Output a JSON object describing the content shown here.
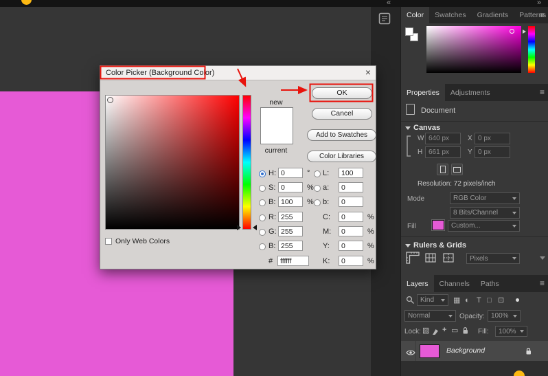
{
  "colors": {
    "pink": "#e65ad6",
    "annotation": "#e8130c",
    "yellow": "#fdb912",
    "hue_magenta": "#ff00e0"
  },
  "topbar": {
    "collapse_left": "«",
    "collapse_right": "»"
  },
  "icons": {
    "menu": "≡",
    "close": "×",
    "pixel_filter": "▦",
    "adjustment_filter": "◐",
    "type_filter": "T",
    "shape_filter": "□",
    "smart_filter": "⊡",
    "lock_transparency": "▨",
    "lock_position": "+",
    "lock_artboard": "▭"
  },
  "dialog": {
    "title": "Color Picker (Background Color)",
    "new_label": "new",
    "current_label": "current",
    "ok_label": "OK",
    "cancel_label": "Cancel",
    "add_to_swatches_label": "Add to Swatches",
    "color_libraries_label": "Color Libraries",
    "only_web_colors_label": "Only Web Colors",
    "hex_label": "#",
    "hex_value": "ffffff",
    "fields": {
      "h": {
        "label": "H:",
        "value": "0",
        "unit": "°"
      },
      "s": {
        "label": "S:",
        "value": "0",
        "unit": "%"
      },
      "b": {
        "label": "B:",
        "value": "100",
        "unit": "%"
      },
      "r": {
        "label": "R:",
        "value": "255",
        "unit": ""
      },
      "g": {
        "label": "G:",
        "value": "255",
        "unit": ""
      },
      "b2": {
        "label": "B:",
        "value": "255",
        "unit": ""
      },
      "l": {
        "label": "L:",
        "value": "100",
        "unit": ""
      },
      "a": {
        "label": "a:",
        "value": "0",
        "unit": ""
      },
      "b_small": {
        "label": "b:",
        "value": "0",
        "unit": ""
      },
      "c": {
        "label": "C:",
        "value": "0",
        "unit": "%"
      },
      "m": {
        "label": "M:",
        "value": "0",
        "unit": "%"
      },
      "y": {
        "label": "Y:",
        "value": "0",
        "unit": "%"
      },
      "k": {
        "label": "K:",
        "value": "0",
        "unit": "%"
      }
    }
  },
  "color_panel": {
    "tabs": [
      "Color",
      "Swatches",
      "Gradients",
      "Patterns"
    ]
  },
  "properties_panel": {
    "tabs": [
      "Properties",
      "Adjustments"
    ],
    "document_label": "Document",
    "canvas_section": "Canvas",
    "w_label": "W",
    "w_value": "640 px",
    "x_label": "X",
    "x_value": "0 px",
    "h_label": "H",
    "h_value": "661 px",
    "y_label": "Y",
    "y_value": "0 px",
    "resolution_text": "Resolution: 72 pixels/inch",
    "mode_label": "Mode",
    "mode_value": "RGB Color",
    "bits_value": "8 Bits/Channel",
    "fill_label": "Fill",
    "fill_value": "Custom...",
    "rulers_section": "Rulers & Grids",
    "units_value": "Pixels"
  },
  "layers_panel": {
    "tabs": [
      "Layers",
      "Channels",
      "Paths"
    ],
    "kind_label": "Kind",
    "blend_value": "Normal",
    "opacity_label": "Opacity:",
    "opacity_value": "100%",
    "lock_label": "Lock:",
    "fill_label": "Fill:",
    "fill_value": "100%",
    "layer_name": "Background"
  }
}
